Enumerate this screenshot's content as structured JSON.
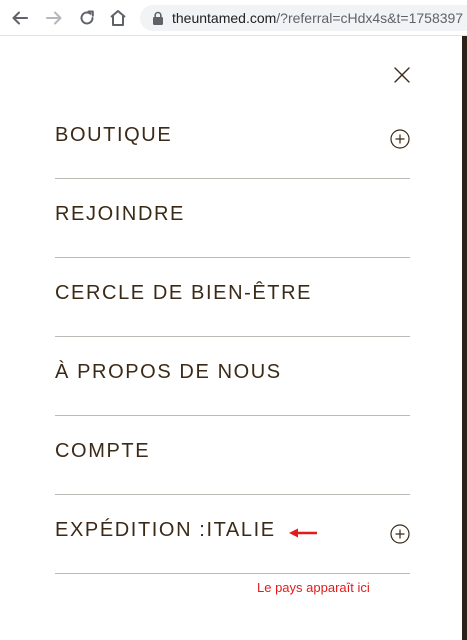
{
  "browser": {
    "url_domain": "theuntamed.com",
    "url_path": "/?referral=cHdx4s&t=1758397"
  },
  "menu": {
    "items": [
      {
        "label": "BOUTIQUE",
        "has_expand": true
      },
      {
        "label": "REJOINDRE",
        "has_expand": false
      },
      {
        "label": "CERCLE DE BIEN-ÊTRE",
        "has_expand": false
      },
      {
        "label": "À PROPOS DE NOUS",
        "has_expand": false
      },
      {
        "label": "COMPTE",
        "has_expand": false
      },
      {
        "label": "EXPÉDITION :ITALIE",
        "has_expand": true
      }
    ]
  },
  "annotation": {
    "text": "Le pays apparaît ici",
    "color": "#e31b1b"
  },
  "colors": {
    "menu_text": "#3b2a17",
    "divider": "#bdbab6"
  },
  "icons": {
    "back": "arrow-left-icon",
    "forward": "arrow-right-icon",
    "reload": "reload-icon",
    "home": "home-icon",
    "lock": "lock-icon",
    "close": "close-icon",
    "expand": "plus-circle-icon",
    "annotation_arrow": "red-arrow-icon"
  }
}
